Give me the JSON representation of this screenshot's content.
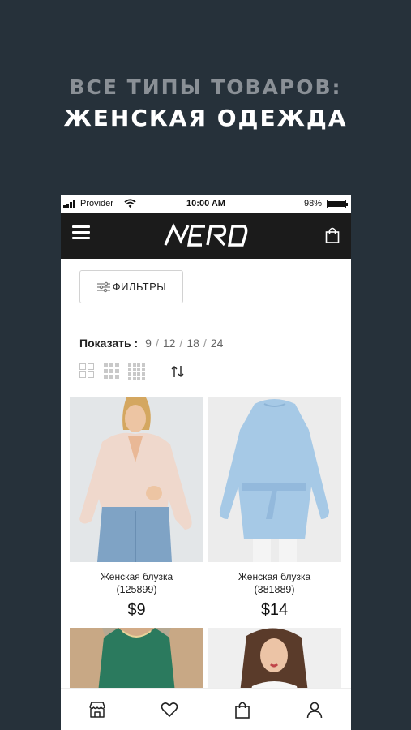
{
  "promo": {
    "line1": "ВСЕ ТИПЫ ТОВАРОВ:",
    "line2": "ЖЕНСКАЯ ОДЕЖДА"
  },
  "status_bar": {
    "carrier": "Provider",
    "time": "10:00 AM",
    "battery": "98%",
    "battery_level": 0.98
  },
  "header": {
    "logo_text": "NERO",
    "menu_icon": "hamburger-icon",
    "cart_icon": "shopping-bag-icon"
  },
  "filters": {
    "label": "ФИЛЬТРЫ",
    "icon": "sliders-icon"
  },
  "show": {
    "label": "Показать :",
    "options": [
      "9",
      "12",
      "18",
      "24"
    ]
  },
  "view": {
    "icons": [
      "grid-2-icon",
      "grid-3-icon",
      "grid-4-icon",
      "sort-icon"
    ]
  },
  "products": [
    {
      "name": "Женская блузка",
      "sku": "(125899)",
      "price": "$9"
    },
    {
      "name": "Женская блузка",
      "sku": "(381889)",
      "price": "$14"
    },
    {
      "name": "",
      "sku": "",
      "price": ""
    },
    {
      "name": "",
      "sku": "",
      "price": ""
    }
  ],
  "tab_bar": {
    "icons": [
      "store-icon",
      "heart-icon",
      "shopping-bag-icon",
      "user-icon"
    ]
  }
}
